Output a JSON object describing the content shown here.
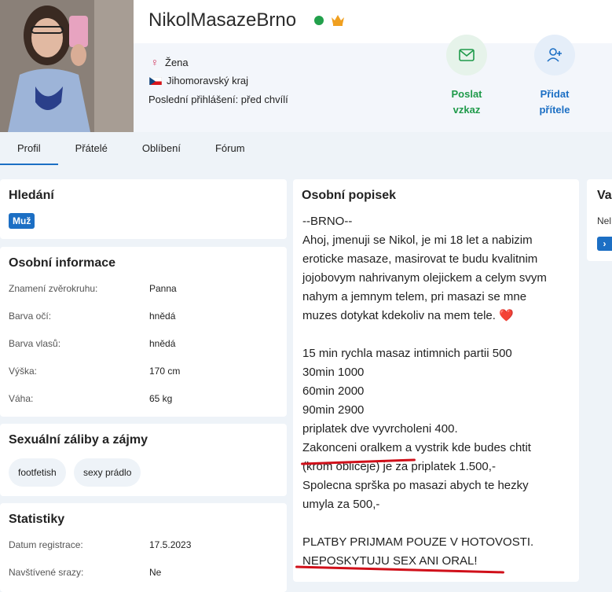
{
  "profile": {
    "username": "NikolMasazeBrno",
    "gender": "Žena",
    "region": "Jihomoravský kraj",
    "last_login": "Poslední přihlášení: před chvílí"
  },
  "actions": {
    "message_line1": "Poslat",
    "message_line2": "vzkaz",
    "friend_line1": "Přidat",
    "friend_line2": "přítele"
  },
  "tabs": [
    {
      "label": "Profil",
      "active": true
    },
    {
      "label": "Přátelé",
      "active": false
    },
    {
      "label": "Oblíbení",
      "active": false
    },
    {
      "label": "Fórum",
      "active": false
    }
  ],
  "searching": {
    "title": "Hledání",
    "tag": "Muž"
  },
  "personal_info": {
    "title": "Osobní informace",
    "rows": [
      {
        "label": "Znamení zvěrokruhu:",
        "value": "Panna"
      },
      {
        "label": "Barva očí:",
        "value": "hnědá"
      },
      {
        "label": "Barva vlasů:",
        "value": "hnědá"
      },
      {
        "label": "Výška:",
        "value": "170 cm"
      },
      {
        "label": "Váha:",
        "value": "65 kg"
      }
    ]
  },
  "interests": {
    "title": "Sexuální záliby a zájmy",
    "chips": [
      "footfetish",
      "sexy prádlo"
    ]
  },
  "stats": {
    "title": "Statistiky",
    "rows": [
      {
        "label": "Datum registrace:",
        "value": "17.5.2023"
      },
      {
        "label": "Navštívené srazy:",
        "value": "Ne"
      }
    ]
  },
  "bio": {
    "title": "Osobní popisek",
    "lines": [
      "--BRNO--",
      "Ahoj, jmenuji se Nikol, je mi 18 let a nabizim",
      "eroticke masaze, masirovat te budu kvalitnim",
      "jojobovym nahrivanym olejickem a celym svym",
      "nahym a jemnym telem, pri masazi se mne",
      "muzes dotykat kdekoliv na mem tele. ❤️",
      "",
      "15 min rychla masaz intimnich partii 500",
      "30min 1000",
      "60min 2000",
      "90min 2900",
      "priplatek dve vyvrcholeni 400.",
      "Zakonceni oralkem a vystrik kde budes chtit",
      "(krom obliceje) je za priplatek 1.500,-",
      "Spolecna sprška po masazi abych te hezky",
      "umyla za 500,-",
      "",
      "PLATBY PRIJMAM POUZE V HOTOVOSTI.",
      "NEPOSKYTUJU SEX ANI ORAL!"
    ]
  },
  "side_card": {
    "title_fragment": "Va",
    "text_fragment": "Nel",
    "button_glyph": "›"
  },
  "colors": {
    "primary": "#1c6fc4",
    "online": "#22a04b",
    "message_green": "#1f9a4a",
    "highlight_red": "#d0101a"
  }
}
